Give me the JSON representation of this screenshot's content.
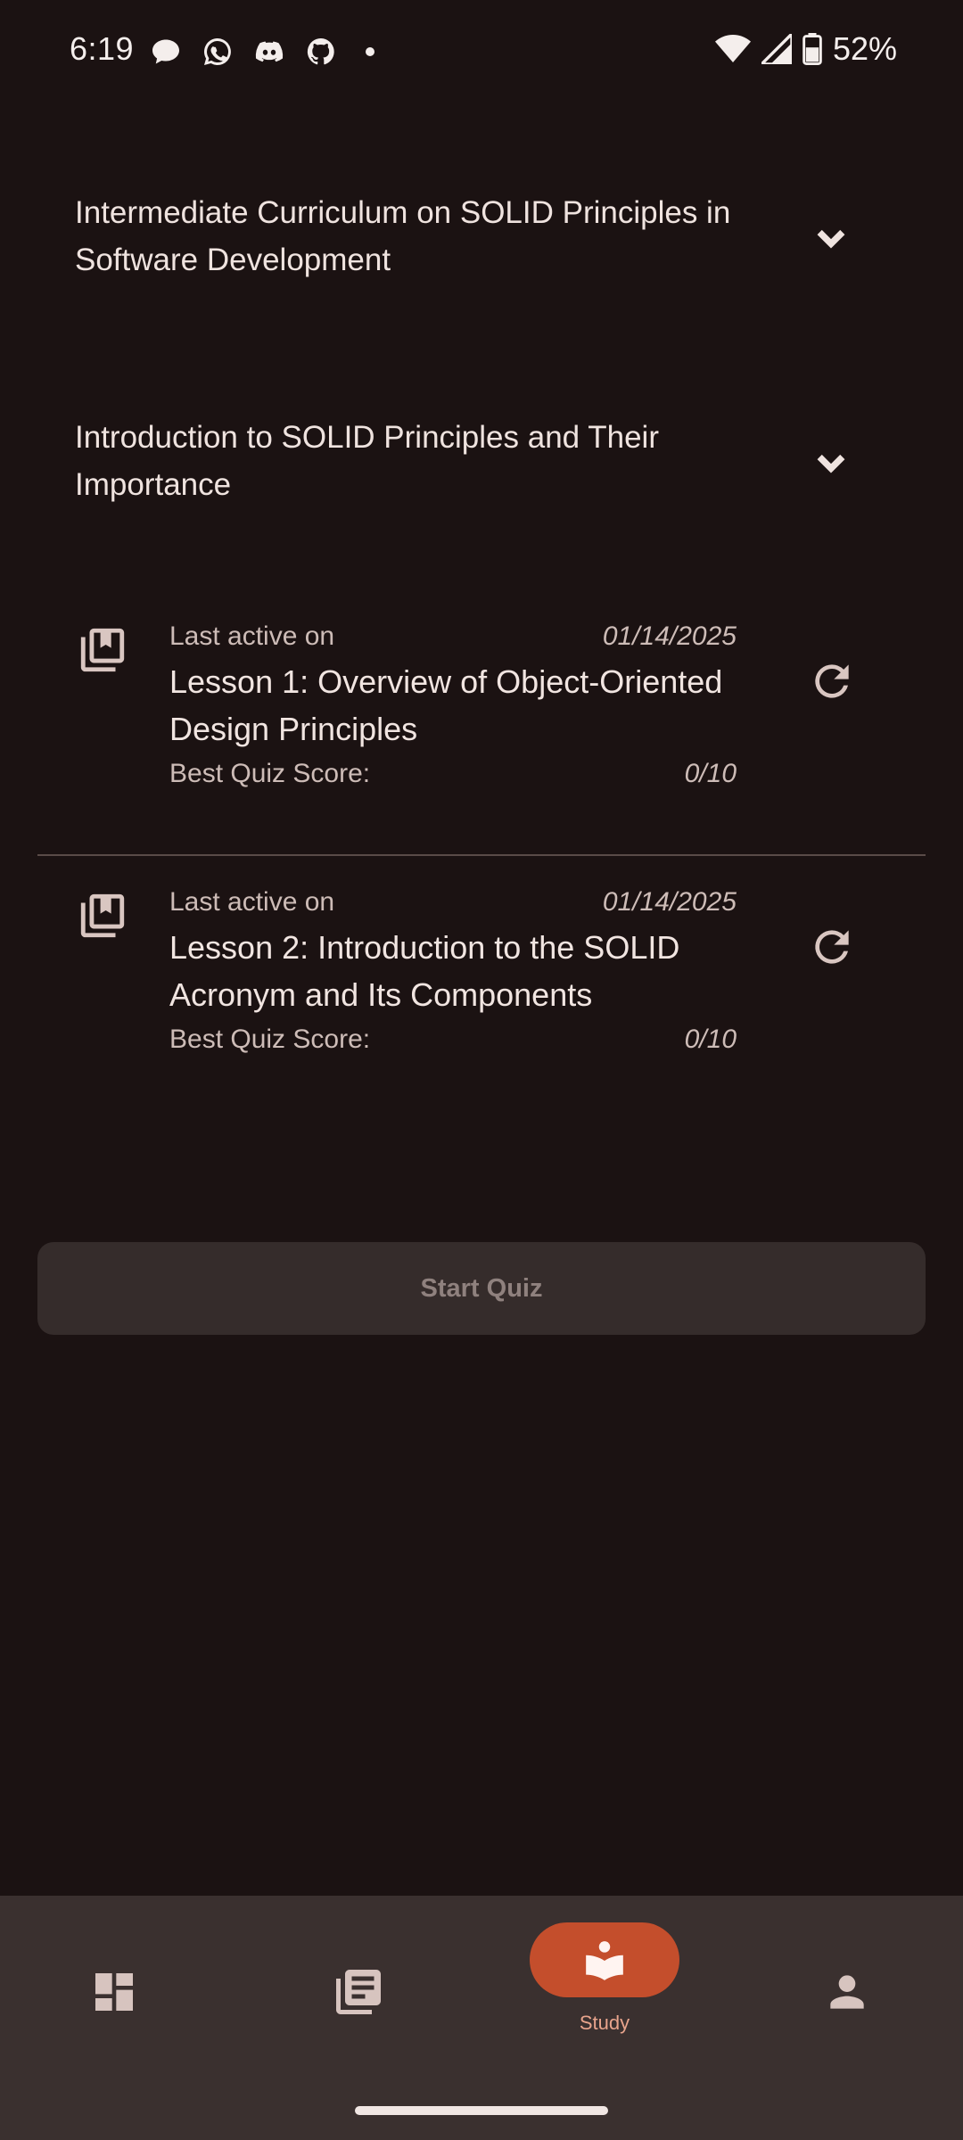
{
  "status_bar": {
    "time": "6:19",
    "battery": "52%"
  },
  "sections": [
    {
      "title": "Intermediate Curriculum on SOLID Principles in Software Development"
    },
    {
      "title": "Introduction to SOLID Principles and Their Importance"
    }
  ],
  "lessons": [
    {
      "last_active_label": "Last active on",
      "last_active_date": "01/14/2025",
      "title": "Lesson 1: Overview of Object-Oriented Design Principles",
      "score_label": "Best Quiz Score:",
      "score_value": "0/10"
    },
    {
      "last_active_label": "Last active on",
      "last_active_date": "01/14/2025",
      "title": "Lesson 2: Introduction to the SOLID Acronym and Its Components",
      "score_label": "Best Quiz Score:",
      "score_value": "0/10"
    }
  ],
  "quiz_button": {
    "label": "Start Quiz"
  },
  "bottom_nav": {
    "items": [
      {
        "icon": "dashboard-icon"
      },
      {
        "icon": "library-icon"
      },
      {
        "icon": "study-book-icon",
        "label": "Study",
        "selected": true
      },
      {
        "icon": "profile-icon"
      }
    ]
  },
  "colors": {
    "background": "#1b1212",
    "accent": "#c44e2c",
    "nav_background": "#3a302f"
  }
}
